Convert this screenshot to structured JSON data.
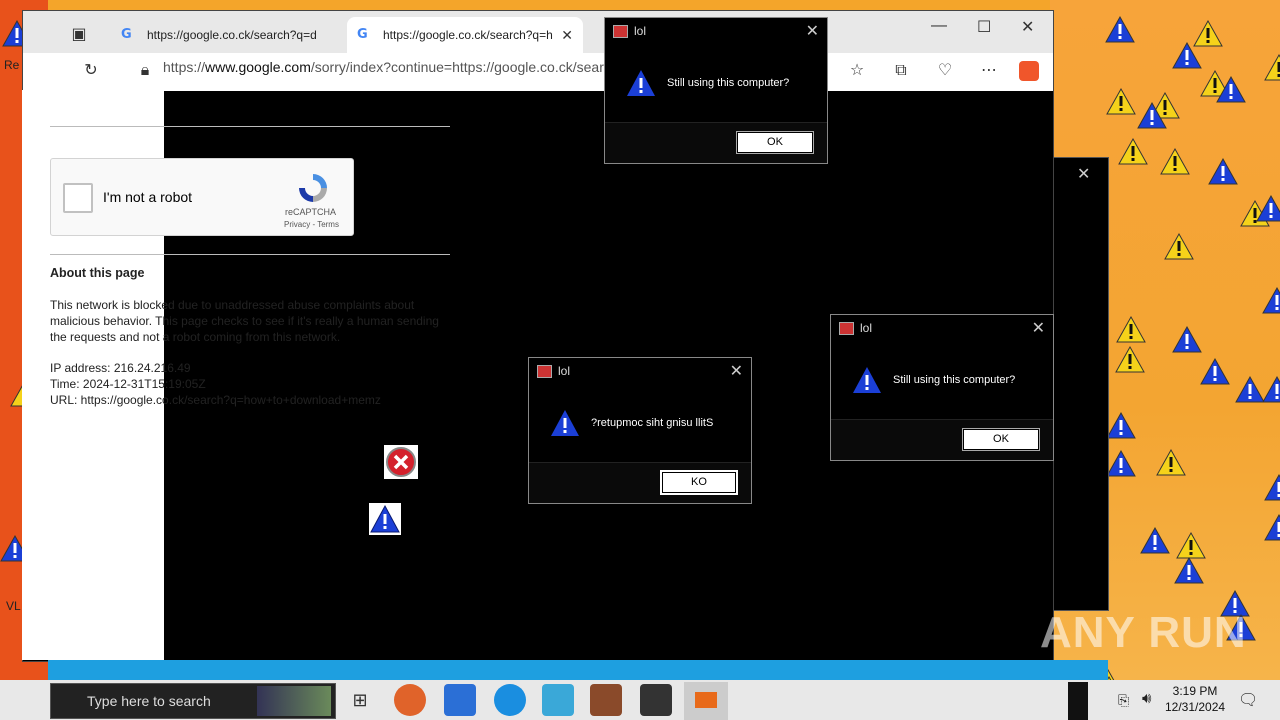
{
  "browser": {
    "tabs": [
      {
        "label": "https://google.co.ck/search?q=d"
      },
      {
        "label": "https://google.co.ck/search?q=h"
      }
    ],
    "url_prefix": "https://",
    "url_host": "www.google.com",
    "url_rest": "/sorry/index?continue=https://google.co.ck/sear"
  },
  "page": {
    "captcha_label": "I'm not a robot",
    "captcha_brand": "reCAPTCHA",
    "captcha_links": "Privacy - Terms",
    "about_heading": "About this page",
    "about_text": "This network is blocked due to unaddressed abuse complaints about malicious behavior. This page checks to see if it's really a human sending the requests and not a robot coming from this network.",
    "ip": "IP address: 216.24.216.49",
    "time": "Time: 2024-12-31T15:19:05Z",
    "url": "URL: https://google.co.ck/search?q=how+to+download+memz"
  },
  "dialogs": [
    {
      "title": "lol",
      "message": "Still using this computer?",
      "button": "OK"
    },
    {
      "title": "lol",
      "message": "?retupmoc siht gnisu llitS",
      "button": "KO"
    },
    {
      "title": "lol",
      "message": "Still using this computer?",
      "button": "OK"
    }
  ],
  "desktop": {
    "left_labels": [
      "Re",
      "VL"
    ]
  },
  "taskbar": {
    "search_placeholder": "Type here to search",
    "time": "3:19 PM",
    "date": "12/31/2024"
  },
  "watermark": "ANY RUN",
  "colors": {
    "warning_yellow": "#f5d21a",
    "warning_blue": "#1b3fd6",
    "taskbar": "#e8e8e8"
  }
}
